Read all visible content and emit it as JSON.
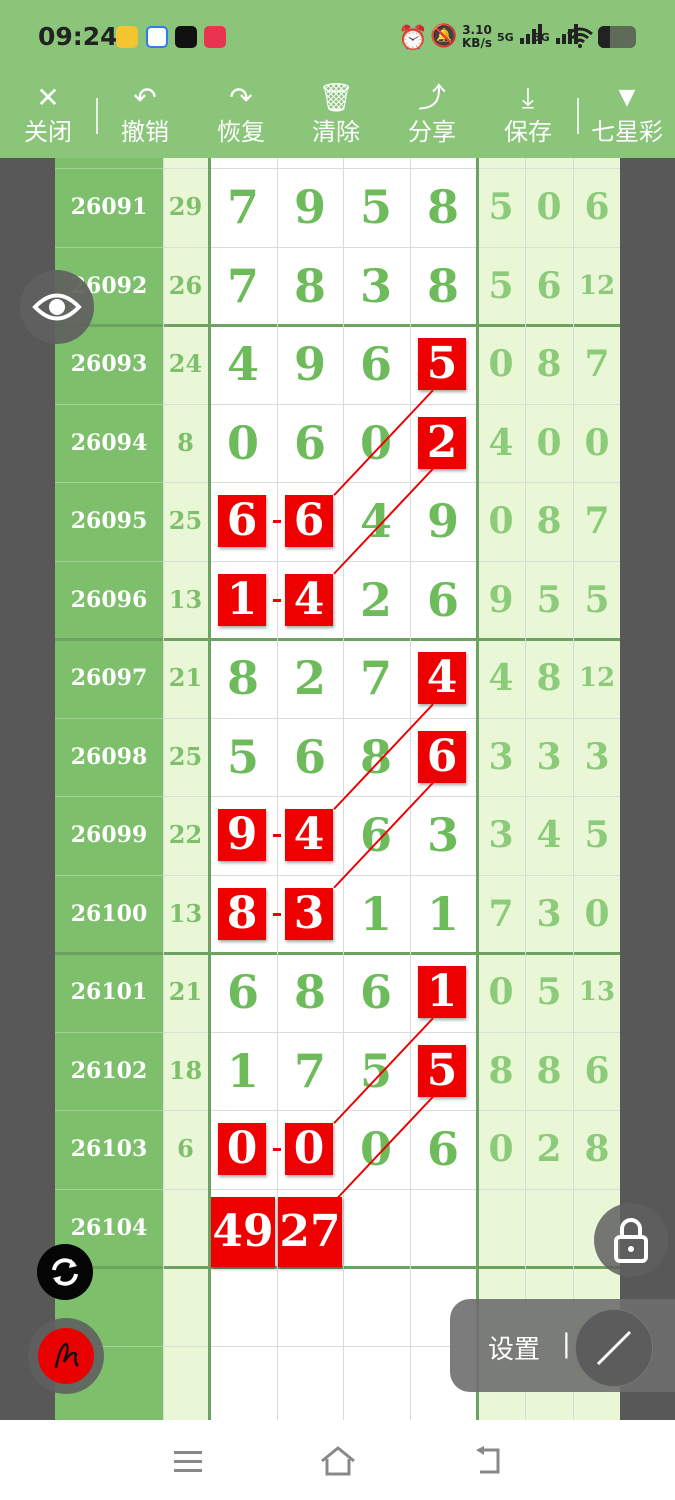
{
  "status_bar": {
    "time": "09:24",
    "network_speed_value": "3.10",
    "network_speed_unit": "KB/s",
    "signal1": "5G",
    "signal2": "5G"
  },
  "toolbar": {
    "close": "关闭",
    "undo": "撤销",
    "redo": "恢复",
    "clear": "清除",
    "share": "分享",
    "save": "保存",
    "lottery": "七星彩"
  },
  "rows": [
    {
      "issue": "26091",
      "sum": "29",
      "d": [
        "7",
        "9",
        "5",
        "8"
      ],
      "r": [
        "5",
        "0",
        "6"
      ]
    },
    {
      "issue": "26092",
      "sum": "26",
      "d": [
        "7",
        "8",
        "3",
        "8"
      ],
      "r": [
        "5",
        "6",
        "12"
      ]
    },
    {
      "issue": "26093",
      "sum": "24",
      "d": [
        "4",
        "9",
        "6",
        "5"
      ],
      "r": [
        "0",
        "8",
        "7"
      ]
    },
    {
      "issue": "26094",
      "sum": "8",
      "d": [
        "0",
        "6",
        "0",
        "2"
      ],
      "r": [
        "4",
        "0",
        "0"
      ]
    },
    {
      "issue": "26095",
      "sum": "25",
      "d": [
        "6",
        "6",
        "4",
        "9"
      ],
      "r": [
        "0",
        "8",
        "7"
      ]
    },
    {
      "issue": "26096",
      "sum": "13",
      "d": [
        "1",
        "4",
        "2",
        "6"
      ],
      "r": [
        "9",
        "5",
        "5"
      ]
    },
    {
      "issue": "26097",
      "sum": "21",
      "d": [
        "8",
        "2",
        "7",
        "4"
      ],
      "r": [
        "4",
        "8",
        "12"
      ]
    },
    {
      "issue": "26098",
      "sum": "25",
      "d": [
        "5",
        "6",
        "8",
        "6"
      ],
      "r": [
        "3",
        "3",
        "3"
      ]
    },
    {
      "issue": "26099",
      "sum": "22",
      "d": [
        "9",
        "4",
        "6",
        "3"
      ],
      "r": [
        "3",
        "4",
        "5"
      ]
    },
    {
      "issue": "26100",
      "sum": "13",
      "d": [
        "8",
        "3",
        "1",
        "1"
      ],
      "r": [
        "7",
        "3",
        "0"
      ]
    },
    {
      "issue": "26101",
      "sum": "21",
      "d": [
        "6",
        "8",
        "6",
        "1"
      ],
      "r": [
        "0",
        "5",
        "13"
      ]
    },
    {
      "issue": "26102",
      "sum": "18",
      "d": [
        "1",
        "7",
        "5",
        "5"
      ],
      "r": [
        "8",
        "8",
        "6"
      ]
    },
    {
      "issue": "26103",
      "sum": "6",
      "d": [
        "0",
        "0",
        "0",
        "6"
      ],
      "r": [
        "0",
        "2",
        "8"
      ]
    },
    {
      "issue": "26104",
      "sum": "",
      "d": [
        "49",
        "27",
        "",
        ""
      ],
      "r": [
        "",
        "",
        ""
      ]
    }
  ],
  "marks": [
    {
      "row": 2,
      "col": 3
    },
    {
      "row": 3,
      "col": 3
    },
    {
      "row": 4,
      "col": 0
    },
    {
      "row": 4,
      "col": 1
    },
    {
      "row": 5,
      "col": 0
    },
    {
      "row": 5,
      "col": 1
    },
    {
      "row": 6,
      "col": 3
    },
    {
      "row": 7,
      "col": 3
    },
    {
      "row": 8,
      "col": 0
    },
    {
      "row": 8,
      "col": 1
    },
    {
      "row": 9,
      "col": 0
    },
    {
      "row": 9,
      "col": 1
    },
    {
      "row": 10,
      "col": 3
    },
    {
      "row": 11,
      "col": 3
    },
    {
      "row": 12,
      "col": 0
    },
    {
      "row": 12,
      "col": 1
    },
    {
      "row": 13,
      "col": 0
    },
    {
      "row": 13,
      "col": 1
    }
  ],
  "links": [
    {
      "from": [
        2,
        3
      ],
      "to": [
        4,
        1
      ]
    },
    {
      "from": [
        3,
        3
      ],
      "to": [
        5,
        1
      ]
    },
    {
      "from": [
        6,
        3
      ],
      "to": [
        8,
        1
      ]
    },
    {
      "from": [
        7,
        3
      ],
      "to": [
        9,
        1
      ]
    },
    {
      "from": [
        10,
        3
      ],
      "to": [
        12,
        1
      ]
    },
    {
      "from": [
        11,
        3
      ],
      "to": [
        13,
        1
      ]
    }
  ],
  "panel": {
    "settings": "设置",
    "separator": "|"
  },
  "colors": {
    "bar_green": "#8ac57a",
    "issue_green": "#7dbf6b",
    "digit_green": "#6dbb5a",
    "mark_red": "#ee0000",
    "pale_green": "#eaf7d6",
    "side_gray": "#585858"
  },
  "icons": {
    "eye": "eye-icon",
    "refresh": "refresh-icon",
    "pen": "pen-icon",
    "lock": "lock-icon",
    "line_tool": "line-tool-icon"
  }
}
